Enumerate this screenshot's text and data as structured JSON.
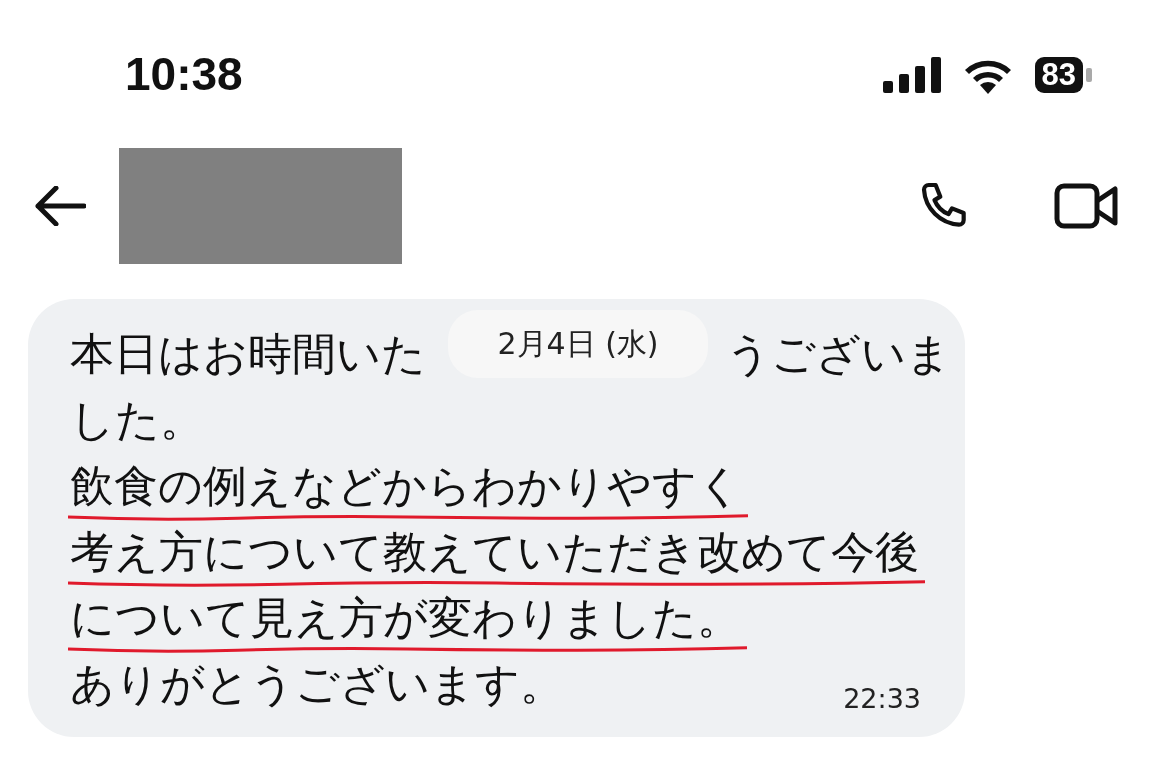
{
  "status_bar": {
    "time": "10:38",
    "battery": "83"
  },
  "header": {
    "contact_redacted": true
  },
  "date_chip": "2月4日 (水)",
  "message": {
    "lines": [
      {
        "parts": [
          "本日はお時間いた",
          "うございま"
        ],
        "underlined": false
      },
      {
        "parts": [
          "した。"
        ],
        "underlined": false
      },
      {
        "parts": [
          "飲食の例えなどからわかりやすく"
        ],
        "underlined": true
      },
      {
        "parts": [
          "考え方について教えていただき改めて今後"
        ],
        "underlined": true
      },
      {
        "parts": [
          "について見え方が変わりました。"
        ],
        "underlined": true
      },
      {
        "parts": [
          "ありがとうございます。"
        ],
        "underlined": false
      }
    ],
    "time": "22:33"
  }
}
